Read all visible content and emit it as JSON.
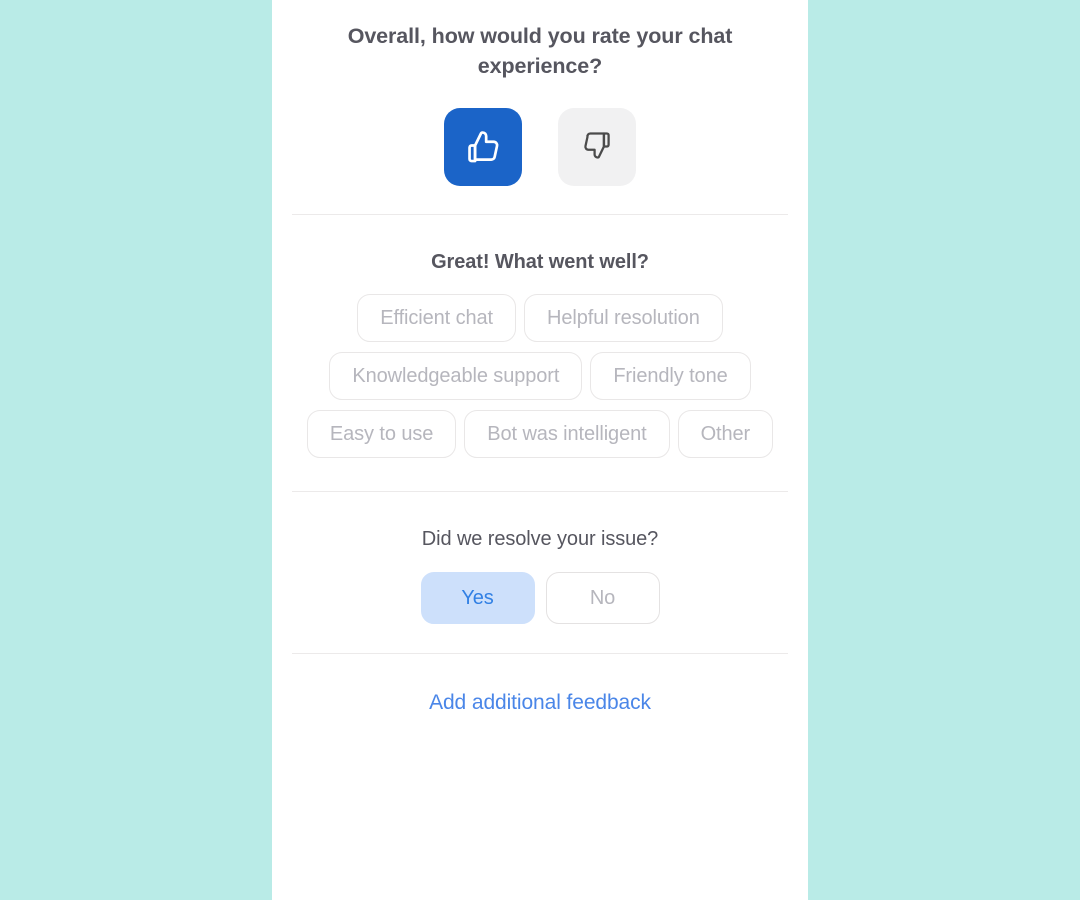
{
  "theme": {
    "page_background": "#b9ebe7",
    "card_background": "#ffffff",
    "accent_blue": "#1b64c8",
    "link_blue": "#4a86e8",
    "selected_chip_bg": "#cde0fb",
    "selected_chip_text": "#3180e4",
    "muted_text": "#b6b6bd",
    "heading_text": "#56565f",
    "divider": "#eceaea",
    "thumb_down_bg": "#f1f1f2"
  },
  "rating": {
    "question": "Overall, how would you rate your chat experience?",
    "thumbs_up": {
      "icon": "thumbs-up-icon",
      "label": "Thumbs up",
      "selected": true
    },
    "thumbs_down": {
      "icon": "thumbs-down-icon",
      "label": "Thumbs down",
      "selected": false
    }
  },
  "tags": {
    "question": "Great! What went well?",
    "options": [
      {
        "label": "Efficient chat",
        "selected": false
      },
      {
        "label": "Helpful resolution",
        "selected": false
      },
      {
        "label": "Knowledgeable support",
        "selected": false
      },
      {
        "label": "Friendly tone",
        "selected": false
      },
      {
        "label": "Easy to use",
        "selected": false
      },
      {
        "label": "Bot was intelligent",
        "selected": false
      },
      {
        "label": "Other",
        "selected": false
      }
    ]
  },
  "resolve": {
    "question": "Did we resolve your issue?",
    "options": [
      {
        "label": "Yes",
        "selected": true
      },
      {
        "label": "No",
        "selected": false
      }
    ]
  },
  "feedback": {
    "link_label": "Add additional feedback"
  }
}
